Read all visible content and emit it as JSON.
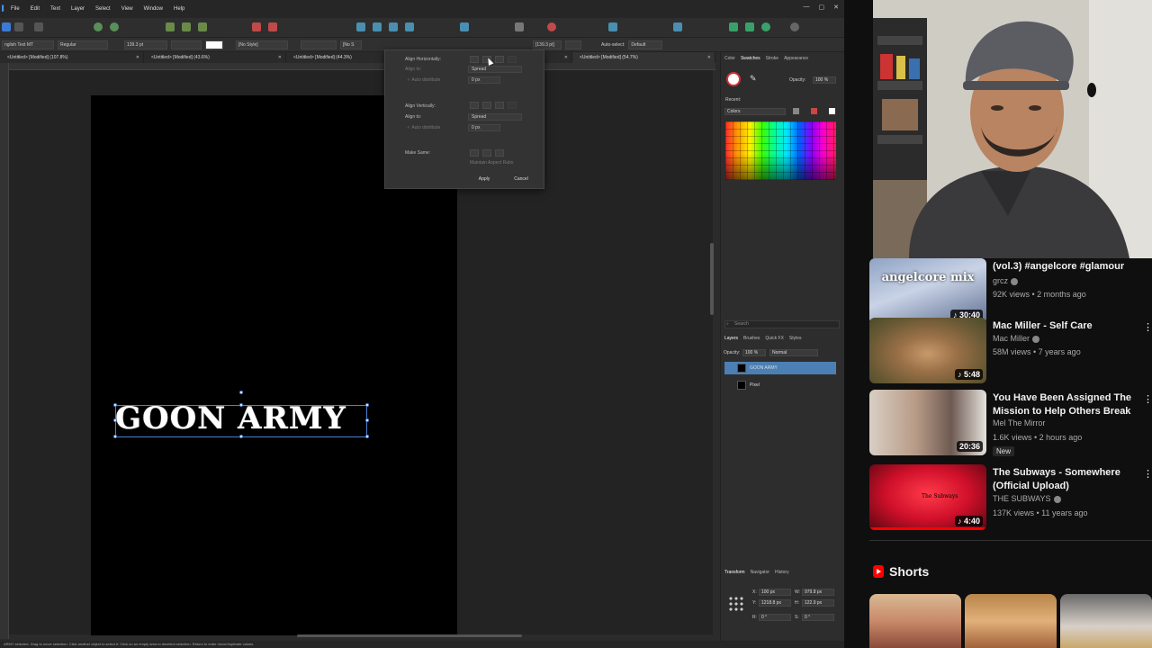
{
  "app": {
    "menu": [
      "File",
      "Edit",
      "Text",
      "Layer",
      "Select",
      "View",
      "Window",
      "Help"
    ],
    "context": {
      "font": "nglish Text MT",
      "style": "Regular",
      "size": "139.3 pt",
      "paragraph_style": "[No Style]",
      "char_style": "[No S",
      "second_size": "[139.3 pt]",
      "auto_select_label": "Auto-select:",
      "auto_select_value": "Default"
    },
    "tabs": [
      "<Untitled> [Modified] (107.8%)",
      "<Untitled> [Modified] (43.6%)",
      "<Untitled> [Modified] (44.3%)",
      "<Untitled> [Modified] (54.7%)"
    ],
    "artboard_text": "GOON ARMY",
    "status": "ARMY selected. Drag to move selection. Click another object to select it. Click on an empty area to deselect selection. Return to enter move/duplicate values."
  },
  "dialog": {
    "align_horizontally": "Align Horizontally:",
    "align_to": "Align to:",
    "h_align_to_value": "Spread",
    "auto_distribute": "Auto distribute",
    "h_spacing": "0 px",
    "align_vertically": "Align Vertically:",
    "v_align_to_value": "Spread",
    "v_spacing": "0 px",
    "make_same": "Make Same:",
    "maintain_aspect": "Maintain Aspect Ratio",
    "apply": "Apply",
    "cancel": "Cancel"
  },
  "studio": {
    "color_tabs": [
      "Color",
      "Swatches",
      "Stroke",
      "Appearance"
    ],
    "opacity_label": "Opacity:",
    "opacity_value": "100 %",
    "recent_label": "Recent:",
    "palette_name": "Colors",
    "search_placeholder": "Search",
    "layer_tabs": [
      "Layers",
      "Brushes",
      "Quick FX",
      "Styles"
    ],
    "layer_opacity_label": "Opacity:",
    "layer_opacity_value": "100 %",
    "blend_mode": "Normal",
    "layers": [
      "GOON ARMY",
      "Pixel"
    ],
    "transform_tabs": [
      "Transform",
      "Navigator",
      "History"
    ],
    "transform": {
      "x_label": "X:",
      "x": "100 px",
      "y_label": "Y:",
      "y": "1218.8 px",
      "w_label": "W:",
      "w": "979.8 px",
      "h_label": "H:",
      "h": "122.9 px",
      "r_label": "R:",
      "r": "0 °",
      "s_label": "S:",
      "s": "0 °"
    }
  },
  "youtube": {
    "videos": [
      {
        "title": "(vol.3) #angelcore #glamour",
        "channel": "grcz",
        "meta": "92K views • 2 months ago",
        "duration": "30:40",
        "thumb_text": "angelcore mix",
        "progress": 0.0
      },
      {
        "title": "Mac Miller - Self Care",
        "channel": "Mac Miller",
        "meta": "58M views • 7 years ago",
        "duration": "5:48",
        "progress": 0.0
      },
      {
        "title": "You Have Been Assigned The Mission to Help Others Break ...",
        "channel": "Mel The Mirror",
        "meta": "1.6K views • 2 hours ago",
        "duration": "20:36",
        "badge": "New",
        "progress": 0.0
      },
      {
        "title": "The Subways - Somewhere (Official Upload)",
        "channel": "THE SUBWAYS",
        "meta": "137K views • 11 years ago",
        "duration": "4:40",
        "thumb_text": "The Subways",
        "progress": 1.0
      }
    ],
    "shorts_title": "Shorts"
  }
}
